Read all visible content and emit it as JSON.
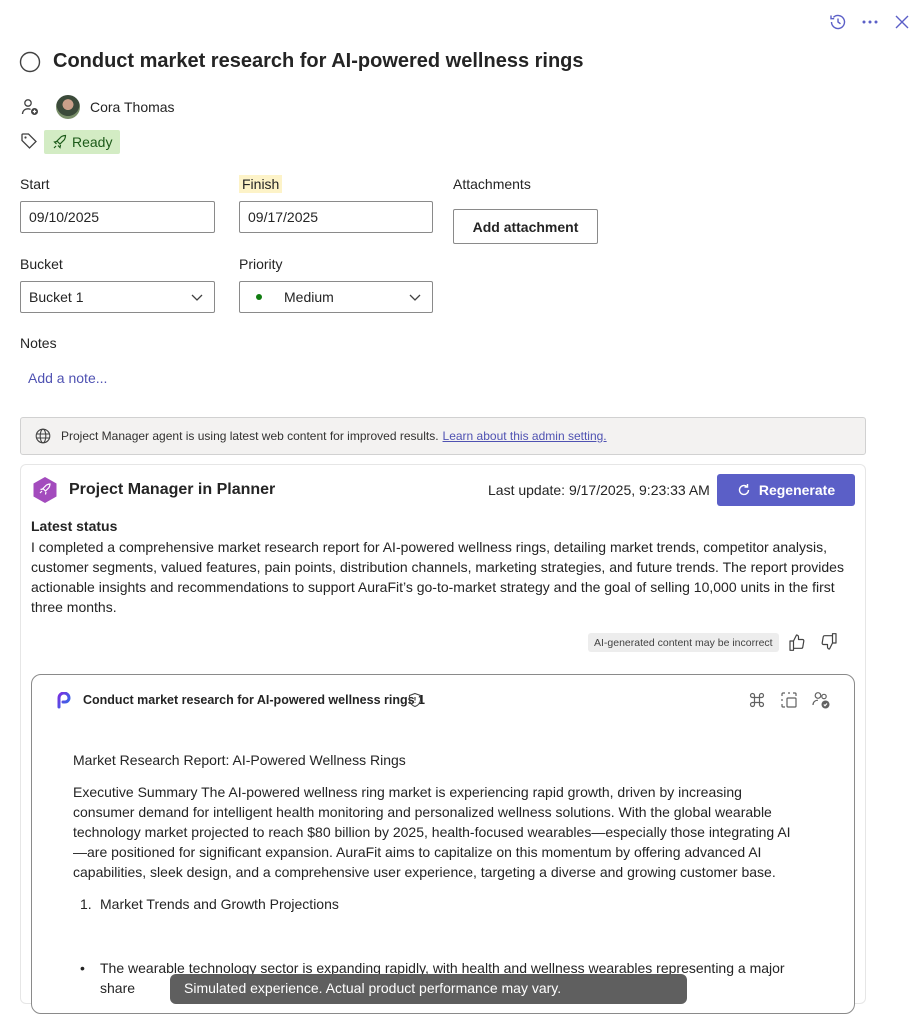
{
  "task": {
    "title": "Conduct market research for AI-powered wellness rings",
    "assignee": "Cora Thomas",
    "label": "Ready"
  },
  "fields": {
    "start_label": "Start",
    "start_value": "09/10/2025",
    "finish_label": "Finish",
    "finish_value": "09/17/2025",
    "attachments_label": "Attachments",
    "add_attachment": "Add attachment",
    "bucket_label": "Bucket",
    "bucket_value": "Bucket 1",
    "priority_label": "Priority",
    "priority_value": "Medium",
    "notes_label": "Notes",
    "notes_placeholder": "Add a note..."
  },
  "banner": {
    "text": "Project Manager agent is using latest web content for improved results.",
    "link": "Learn about this admin setting."
  },
  "agent": {
    "name": "Project Manager in Planner",
    "last_update": "Last update: 9/17/2025, 9:23:33 AM",
    "regenerate": "Regenerate",
    "status_heading": "Latest status",
    "status_text": "I completed a comprehensive market research report for AI-powered wellness rings, detailing market trends, competitor analysis, customer segments, valued features, pain points, distribution channels, marketing strategies, and future trends. The report provides actionable insights and recommendations to support AuraFit’s go-to-market strategy and the goal of selling 10,000 units in the first three months.",
    "ai_disclaimer": "AI-generated content may be incorrect"
  },
  "document": {
    "title": "Conduct market research for AI-powered wellness rings 1",
    "heading": "Market Research Report: AI-Powered Wellness Rings",
    "summary": "Executive Summary The AI-powered wellness ring market is experiencing rapid growth, driven by increasing consumer demand for intelligent health monitoring and personalized wellness solutions. With the global wearable technology market projected to reach $80 billion by 2025, health-focused wearables—especially those integrating AI —are positioned for significant expansion. AuraFit aims to capitalize on this momentum by offering advanced AI capabilities, sleek design, and a comprehensive user experience, targeting a diverse and growing customer base.",
    "list_item_1": "Market Trends and Growth Projections",
    "bullet_1": "The wearable technology sector is expanding rapidly, with health and wellness wearables representing a major share"
  },
  "toast": {
    "text": "Simulated experience. Actual product performance may vary."
  },
  "colors": {
    "accent": "#5b5fc7",
    "tag_bg": "#d3ecc4",
    "finish_highlight": "#fdf3c8",
    "priority_dot": "#107c10"
  },
  "icons": [
    "history-icon",
    "more-icon",
    "close-icon",
    "circle-checkbox-icon",
    "assign-person-icon",
    "avatar",
    "tag-icon",
    "rocket-icon",
    "chevron-down-icon",
    "globe-icon",
    "agent-logo-icon",
    "refresh-icon",
    "thumbs-up-icon",
    "thumbs-down-icon",
    "loop-logo-icon",
    "shield-icon",
    "command-icon",
    "select-icon",
    "share-people-icon"
  ]
}
